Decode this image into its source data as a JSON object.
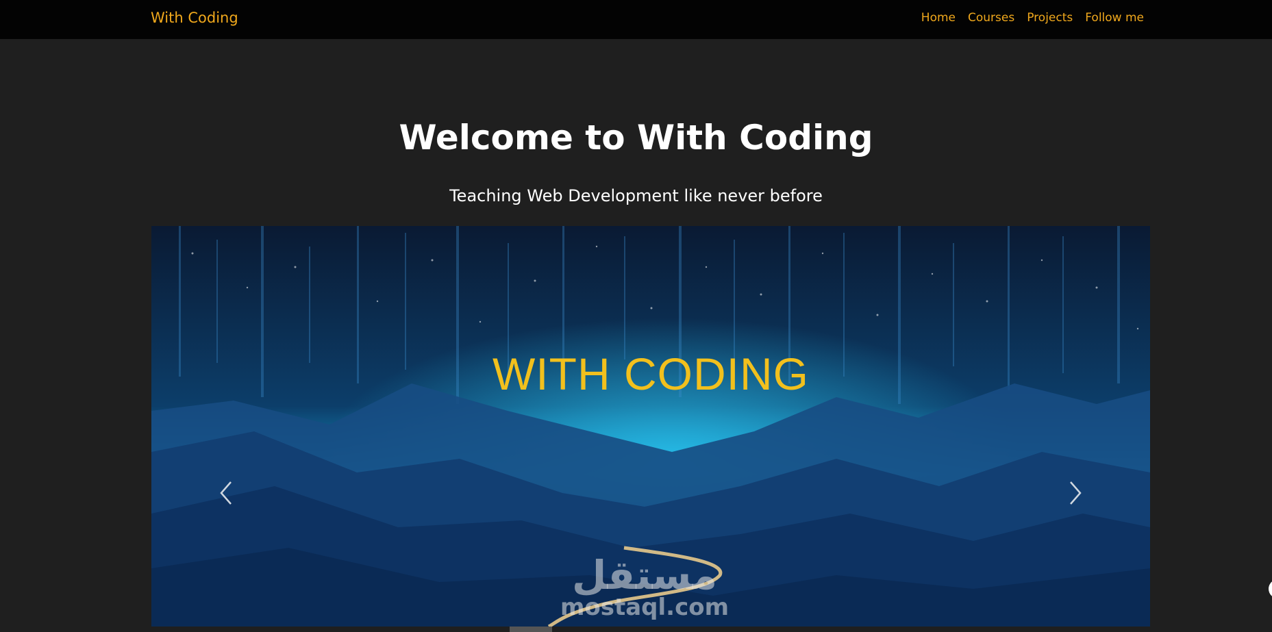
{
  "navbar": {
    "brand": "With Coding",
    "links": [
      "Home",
      "Courses",
      "Projects",
      "Follow me"
    ]
  },
  "hero": {
    "title": "Welcome to With Coding",
    "subtitle": "Teaching Web Development like never before"
  },
  "carousel": {
    "caption": "WITH CODING",
    "prev_icon": "chevron-left-icon",
    "next_icon": "chevron-right-icon"
  },
  "watermark": {
    "arabic": "مستقل",
    "site": "mostaql.com"
  },
  "colors": {
    "accent": "#f0a81c",
    "caption": "#f2c01d",
    "background": "#1f1f1f",
    "navbar": "#030303"
  }
}
